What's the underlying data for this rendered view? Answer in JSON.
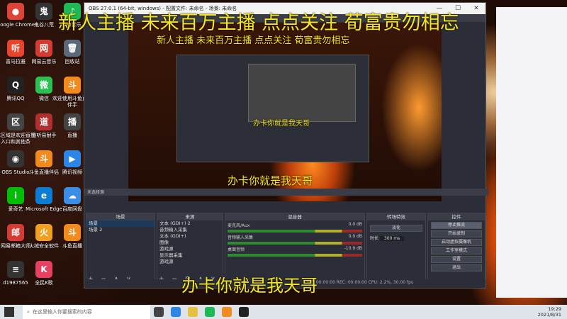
{
  "desktop": {
    "icons": [
      {
        "label": "Google Chrome",
        "glyph": "●",
        "color": "#db4437"
      },
      {
        "label": "鬼谷八荒",
        "glyph": "鬼",
        "color": "#333"
      },
      {
        "label": "QQ音乐",
        "glyph": "♪",
        "color": "#1db954"
      },
      {
        "label": "喜马拉雅",
        "glyph": "听",
        "color": "#e8442c"
      },
      {
        "label": "网易云音乐",
        "glyph": "网",
        "color": "#d43c33"
      },
      {
        "label": "回收站",
        "glyph": "🗑",
        "color": "#5a6a7a"
      },
      {
        "label": "腾讯QQ",
        "glyph": "Q",
        "color": "#222"
      },
      {
        "label": "微信",
        "glyph": "微",
        "color": "#2ac150"
      },
      {
        "label": "欢迎使用斗鱼直播伴手",
        "glyph": "斗",
        "color": "#f28a1d"
      },
      {
        "label": "本区域是欢迎直播入口和其他条",
        "glyph": "区",
        "color": "#444"
      },
      {
        "label": "道听易耐手",
        "glyph": "道",
        "color": "#b03030"
      },
      {
        "label": "直播",
        "glyph": "播",
        "color": "#444"
      },
      {
        "label": "OBS Studio",
        "glyph": "◉",
        "color": "#333"
      },
      {
        "label": "斗鱼直播伴侣",
        "glyph": "斗",
        "color": "#f28a1d"
      },
      {
        "label": "腾讯视频",
        "glyph": "▶",
        "color": "#2c86e8"
      },
      {
        "label": "爱奇艺",
        "glyph": "i",
        "color": "#00be06"
      },
      {
        "label": "Microsoft Edge",
        "glyph": "e",
        "color": "#0a7cd4"
      },
      {
        "label": "百度网盘",
        "glyph": "☁",
        "color": "#3a8ee6"
      },
      {
        "label": "网易邮箱大师",
        "glyph": "邮",
        "color": "#d43c33"
      },
      {
        "label": "火绒安全软件",
        "glyph": "火",
        "color": "#f0a020"
      },
      {
        "label": "斗鱼直播",
        "glyph": "斗",
        "color": "#f28a1d"
      },
      {
        "label": "d1987565",
        "glyph": "≡",
        "color": "#333"
      },
      {
        "label": "全民K歌",
        "glyph": "K",
        "color": "#e84060"
      }
    ]
  },
  "overlay": {
    "banner_main": "新人主播 未来百万主播 点点关注 荀富贵勿相忘",
    "banner_nested": "新人主播 未来百万主播 点点关注 荀富贵勿相忘",
    "caption_mid": "办卡你就是我天哥",
    "caption_small": "办卡你就是我天哥",
    "caption_bottom": "办卡你就是我天哥"
  },
  "obs": {
    "title": "OBS 27.0.1 (64-bit, windows) - 配置文件: 未命名 - 场景: 未命名",
    "min": "—",
    "max": "☐",
    "close": "✕",
    "preview_label": "未选择源",
    "scenes": {
      "header": "场景",
      "items": [
        "场景",
        "场景 2"
      ]
    },
    "sources": {
      "header": "来源",
      "items": [
        "文本 (GDI+) 2",
        "音频输入采集",
        "文本 (GDI+)",
        "图像",
        "游戏源",
        "显示器采集",
        "游戏源"
      ]
    },
    "mixer": {
      "header": "混音器",
      "tracks": [
        {
          "name": "麦克风/Aux",
          "db": "0.0 dB"
        },
        {
          "name": "音频输入采集",
          "db": "0.0 dB"
        },
        {
          "name": "桌面音频",
          "db": "-10.9 dB"
        }
      ]
    },
    "transitions": {
      "header": "转场特效",
      "type": "淡化",
      "duration_label": "时长",
      "duration": "300 ms"
    },
    "controls": {
      "header": "控件",
      "buttons": [
        "停止推流",
        "开始录制",
        "启动虚拟摄像机",
        "工作室模式",
        "设置",
        "退出"
      ]
    },
    "status": "LIVE: 00:00:00   REC: 00:00:00   CPU: 2.2%, 30.00 fps"
  },
  "taskbar": {
    "search_placeholder": "在这里输入你要搜索的内容",
    "time": "19:29",
    "date": "2021/8/31"
  }
}
